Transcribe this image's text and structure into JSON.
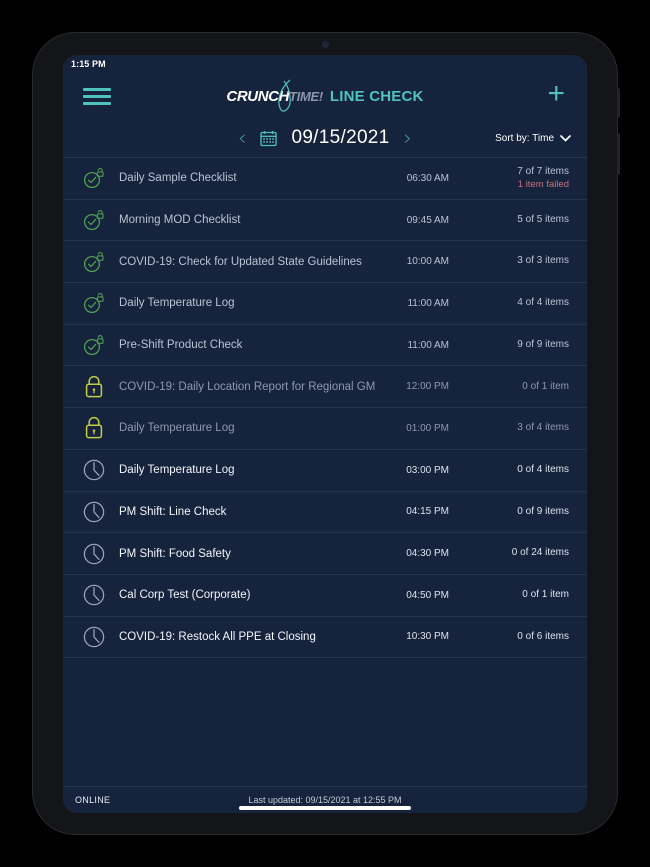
{
  "status_bar": {
    "time": "1:15 PM"
  },
  "header": {
    "menu_icon": "hamburger-menu-icon",
    "brand_primary": "CRUNCH",
    "brand_secondary": "TIME!",
    "app_name": "LINE CHECK",
    "add_label": "+"
  },
  "date_toolbar": {
    "prev_label": "‹",
    "next_label": "›",
    "calendar_icon": "calendar-icon",
    "date": "09/15/2021",
    "sort_label": "Sort by: Time",
    "chevron": "chevron-down-icon"
  },
  "checklist": {
    "rows": [
      {
        "title": "Daily Sample Checklist",
        "time": "06:30 AM",
        "count": "7 of 7 items",
        "failed": "1 item failed",
        "state": "complete",
        "icon": "check-circle-unlocked-icon"
      },
      {
        "title": "Morning MOD Checklist",
        "time": "09:45 AM",
        "count": "5 of 5 items",
        "failed": "",
        "state": "complete",
        "icon": "check-circle-unlocked-icon"
      },
      {
        "title": "COVID-19: Check for Updated State Guidelines",
        "time": "10:00 AM",
        "count": "3 of 3 items",
        "failed": "",
        "state": "complete",
        "icon": "check-circle-unlocked-icon"
      },
      {
        "title": "Daily Temperature Log",
        "time": "11:00 AM",
        "count": "4 of 4 items",
        "failed": "",
        "state": "complete",
        "icon": "check-circle-unlocked-icon"
      },
      {
        "title": "Pre-Shift Product Check",
        "time": "11:00 AM",
        "count": "9 of 9 items",
        "failed": "",
        "state": "complete",
        "icon": "check-circle-unlocked-icon"
      },
      {
        "title": "COVID-19: Daily Location Report for Regional GM",
        "time": "12:00 PM",
        "count": "0 of 1 item",
        "failed": "",
        "state": "locked",
        "icon": "padlock-icon"
      },
      {
        "title": "Daily Temperature Log",
        "time": "01:00 PM",
        "count": "3 of 4 items",
        "failed": "",
        "state": "locked",
        "icon": "padlock-icon"
      },
      {
        "title": "Daily Temperature Log",
        "time": "03:00 PM",
        "count": "0 of 4 items",
        "failed": "",
        "state": "upcoming",
        "icon": "clock-icon"
      },
      {
        "title": "PM Shift: Line Check",
        "time": "04:15 PM",
        "count": "0 of 9 items",
        "failed": "",
        "state": "upcoming",
        "icon": "clock-icon"
      },
      {
        "title": "PM Shift: Food Safety",
        "time": "04:30 PM",
        "count": "0 of 24 items",
        "failed": "",
        "state": "upcoming",
        "icon": "clock-icon"
      },
      {
        "title": "Cal Corp Test (Corporate)",
        "time": "04:50 PM",
        "count": "0 of 1 item",
        "failed": "",
        "state": "upcoming",
        "icon": "clock-icon"
      },
      {
        "title": "COVID-19: Restock All PPE at Closing",
        "time": "10:30 PM",
        "count": "0 of 6 items",
        "failed": "",
        "state": "upcoming",
        "icon": "clock-icon"
      }
    ]
  },
  "footer": {
    "connection_status": "ONLINE",
    "last_updated": "Last updated: 09/15/2021 at 12:55 PM"
  },
  "colors": {
    "screen_bg": "#16233c",
    "accent_teal": "#4ec3c0",
    "complete_green": "#4f9e52",
    "locked_yellow": "#c2cc46",
    "clock_gray": "#9aa6b8",
    "failed_red": "#c8737c"
  }
}
